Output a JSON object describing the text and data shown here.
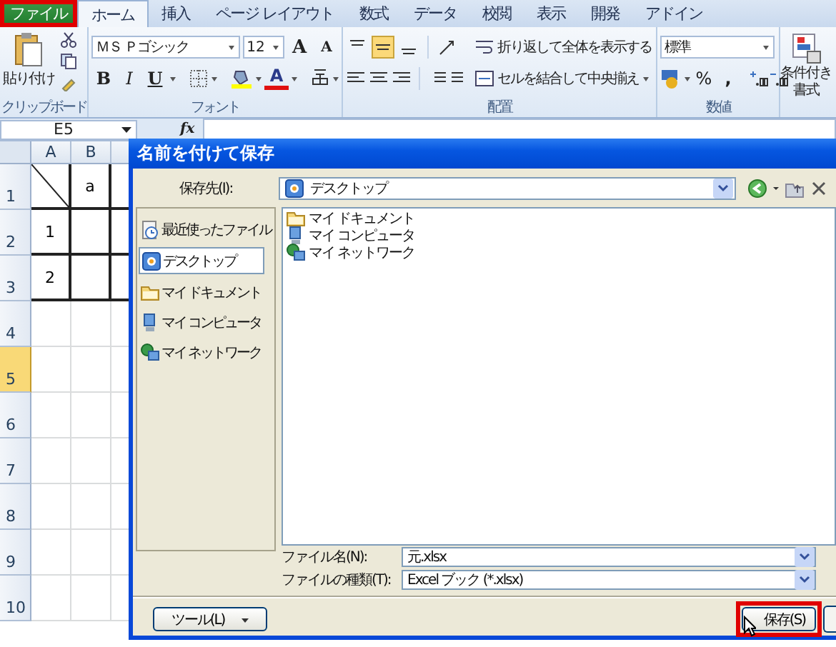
{
  "ribbon": {
    "tabs": [
      {
        "kind": "file",
        "label": "ファイル",
        "selected": false,
        "outlined": true
      },
      {
        "kind": "tab",
        "label": "ホーム",
        "selected": true,
        "outlined": false
      },
      {
        "kind": "tab",
        "label": "挿入",
        "selected": false,
        "outlined": false
      },
      {
        "kind": "tab",
        "label": "ページ レイアウト",
        "selected": false,
        "outlined": false
      },
      {
        "kind": "tab",
        "label": "数式",
        "selected": false,
        "outlined": false
      },
      {
        "kind": "tab",
        "label": "データ",
        "selected": false,
        "outlined": false
      },
      {
        "kind": "tab",
        "label": "校閲",
        "selected": false,
        "outlined": false
      },
      {
        "kind": "tab",
        "label": "表示",
        "selected": false,
        "outlined": false
      },
      {
        "kind": "tab",
        "label": "開発",
        "selected": false,
        "outlined": false
      },
      {
        "kind": "tab",
        "label": "アドイン",
        "selected": false,
        "outlined": false
      }
    ],
    "clipboard": {
      "paste": "貼り付け",
      "label": "クリップボード"
    },
    "font": {
      "name": "ＭＳ Ｐゴシック",
      "size": "12",
      "label": "フォント",
      "size_buttons": [
        {
          "kind": "grow",
          "label": "A"
        },
        {
          "kind": "shrink",
          "label": "A"
        }
      ],
      "style_buttons": [
        {
          "kind": "bold",
          "label": "B"
        },
        {
          "kind": "italic",
          "label": "I"
        },
        {
          "kind": "underline",
          "label": "U"
        },
        {
          "kind": "border"
        },
        {
          "kind": "fill"
        },
        {
          "kind": "color",
          "label": "A"
        },
        {
          "kind": "phonetic"
        }
      ]
    },
    "alignment": {
      "label": "配置",
      "vertical": [
        {
          "kind": "top",
          "pressed": false
        },
        {
          "kind": "middle",
          "pressed": true
        },
        {
          "kind": "bottom",
          "pressed": false
        }
      ],
      "wrap": "折り返して全体を表示する",
      "merge": "セルを結合して中央揃え"
    },
    "number": {
      "format": "標準",
      "label": "数値",
      "buttons": [
        {
          "kind": "currency"
        },
        {
          "kind": "percent",
          "label": "%"
        },
        {
          "kind": "comma",
          "label": ","
        },
        {
          "kind": "inc"
        },
        {
          "kind": "dec"
        }
      ]
    },
    "styles": {
      "conditional": [
        "条件付き",
        "書式"
      ]
    }
  },
  "formula_bar": {
    "name_box": "E5",
    "fx": "fx"
  },
  "sheet": {
    "columns": [
      "A",
      "B"
    ],
    "rows": [
      {
        "label": "1",
        "selected": false,
        "bordered": true,
        "cells": [
          {
            "kind": "diagonal"
          },
          {
            "kind": "text",
            "text": "a"
          }
        ]
      },
      {
        "label": "2",
        "selected": false,
        "bordered": true,
        "cells": [
          {
            "kind": "text",
            "text": "1"
          }
        ]
      },
      {
        "label": "3",
        "selected": false,
        "bordered": true,
        "cells": [
          {
            "kind": "text",
            "text": "2"
          }
        ]
      },
      {
        "label": "4",
        "selected": false,
        "bordered": false
      },
      {
        "label": "5",
        "selected": true,
        "bordered": false
      },
      {
        "label": "6",
        "selected": false,
        "bordered": false
      },
      {
        "label": "7",
        "selected": false,
        "bordered": false
      },
      {
        "label": "8",
        "selected": false,
        "bordered": false
      },
      {
        "label": "9",
        "selected": false,
        "bordered": false
      },
      {
        "label": "10",
        "selected": false,
        "bordered": false
      }
    ]
  },
  "dialog": {
    "title": "名前を付けて保存",
    "save_in_label": "保存先(I):",
    "save_in": "デスクトップ",
    "places": [
      {
        "kind": "recent",
        "label": "最近使ったファイル",
        "selected": false
      },
      {
        "kind": "desktop",
        "label": "デスクトップ",
        "selected": true
      },
      {
        "kind": "folder",
        "label": "マイ ドキュメント",
        "selected": false
      },
      {
        "kind": "computer",
        "label": "マイ コンピュータ",
        "selected": false
      },
      {
        "kind": "network",
        "label": "マイ ネットワーク",
        "selected": false
      }
    ],
    "files": [
      {
        "kind": "folder",
        "label": "マイ ドキュメント"
      },
      {
        "kind": "computer",
        "label": "マイ コンピュータ"
      },
      {
        "kind": "network",
        "label": "マイ ネットワーク"
      }
    ],
    "file_name_label": "ファイル名(N):",
    "file_name": "元.xlsx",
    "file_type_label": "ファイルの種類(T):",
    "file_type": "Excel ブック (*.xlsx)",
    "buttons": [
      {
        "kind": "tools",
        "label": "ツール(L)",
        "outlined": false
      },
      {
        "kind": "save",
        "label": "保存(S)",
        "outlined": true
      }
    ]
  }
}
